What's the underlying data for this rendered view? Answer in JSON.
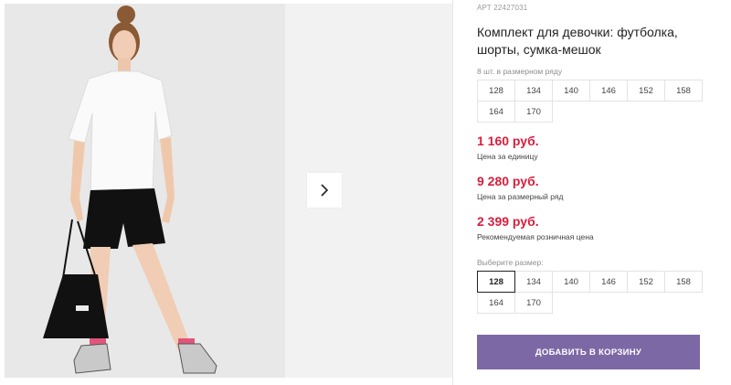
{
  "product": {
    "sku_label": "АРТ",
    "sku": "22427031",
    "title": "Комплект для девочки: футболка, шорты, сумка-мешок",
    "pack_label": "8 шт. в размерном ряду",
    "pack_sizes": [
      "128",
      "134",
      "140",
      "146",
      "152",
      "158",
      "164",
      "170"
    ],
    "prices": {
      "unit_price": "1 160 руб.",
      "unit_price_label": "Цена за единицу",
      "pack_price": "9 280 руб.",
      "pack_price_label": "Цена за размерный ряд",
      "retail_price": "2 399 руб.",
      "retail_price_label": "Рекомендуемая розничная цена"
    },
    "choose_size_label": "Выберите размер:",
    "sizes": [
      "128",
      "134",
      "140",
      "146",
      "152",
      "158",
      "164",
      "170"
    ],
    "selected_size": "128",
    "add_to_cart_label": "ДОБАВИТЬ В КОРЗИНУ"
  },
  "colors": {
    "price_red": "#d81e3c",
    "cart_button": "#7d68a6"
  },
  "icons": {
    "next": "chevron-right-icon"
  }
}
